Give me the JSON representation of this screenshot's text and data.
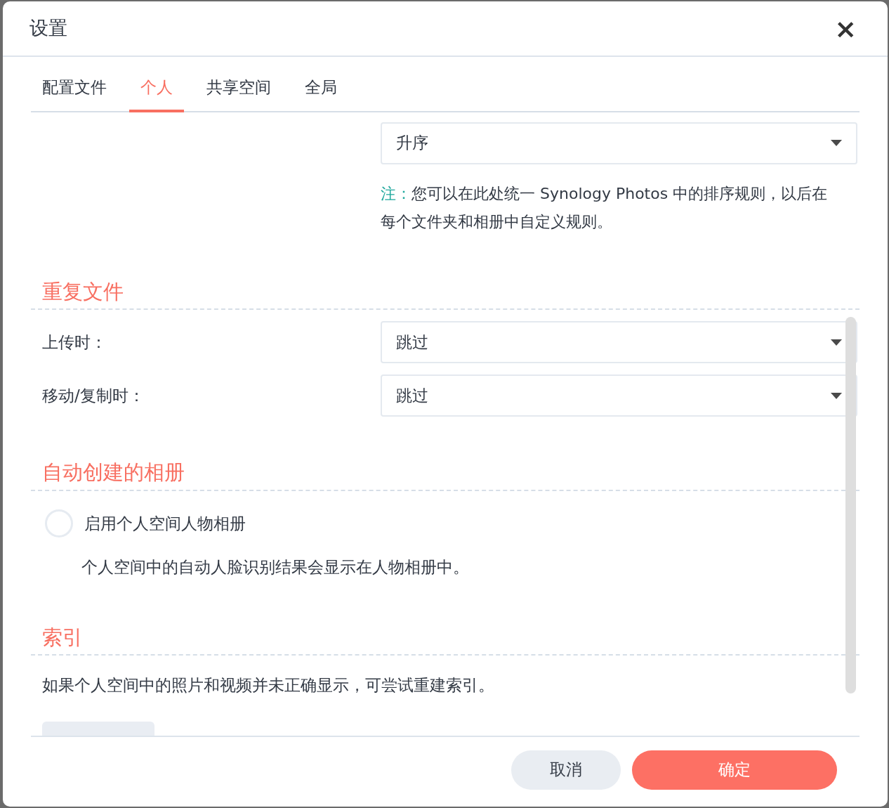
{
  "dialog": {
    "title": "设置",
    "close": "×"
  },
  "tabs": [
    {
      "label": "配置文件",
      "selected": false
    },
    {
      "label": "个人",
      "selected": true
    },
    {
      "label": "共享空间",
      "selected": false
    },
    {
      "label": "全局",
      "selected": false
    }
  ],
  "sort_select": {
    "value": "升序"
  },
  "note": {
    "label": "注：",
    "text": "您可以在此处统一 Synology Photos 中的排序规则，以后在每个文件夹和相册中自定义规则。"
  },
  "sections": [
    {
      "title": "重复文件",
      "rows": [
        {
          "kind": "select",
          "label": "上传时：",
          "value": "跳过"
        },
        {
          "kind": "select",
          "label": "移动/复制时：",
          "value": "跳过"
        }
      ]
    },
    {
      "title": "自动创建的相册",
      "rows": [
        {
          "kind": "radio",
          "label": "启用个人空间人物相册",
          "checked": false,
          "description": "个人空间中的自动人脸识别结果会显示在人物相册中。"
        }
      ]
    },
    {
      "title": "索引",
      "rows": [
        {
          "kind": "text",
          "text": "如果个人空间中的照片和视频并未正确显示，可尝试重建索引。"
        },
        {
          "kind": "clipped_button"
        }
      ]
    }
  ],
  "footer": {
    "buttons": [
      {
        "label": "取消",
        "kind": "secondary"
      },
      {
        "label": "确定",
        "kind": "primary"
      }
    ]
  }
}
